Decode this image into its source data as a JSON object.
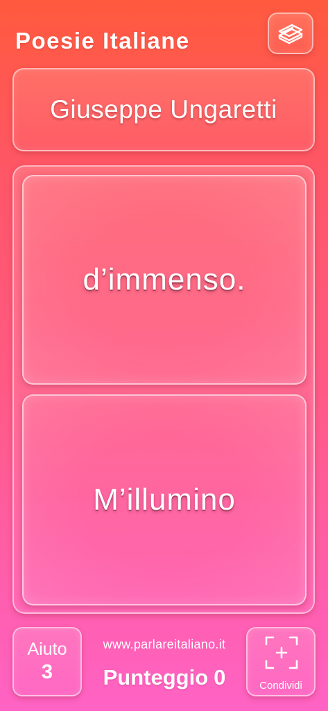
{
  "header": {
    "title": "Poesie Italiane",
    "books_icon": "books-icon"
  },
  "poem": {
    "author": "Giuseppe Ungaretti",
    "verses": [
      "d’immenso.",
      "M’illumino"
    ]
  },
  "footer": {
    "help_label": "Aiuto",
    "help_count": "3",
    "website": "www.parlareitaliano.it",
    "score_label": "Punteggio",
    "score_value": "0",
    "share_label": "Condividi",
    "share_icon": "share-frame-plus-icon"
  },
  "colors": {
    "gradient_top": "#ff5a3e",
    "gradient_bottom": "#ff63c4",
    "text": "#ffffff"
  }
}
